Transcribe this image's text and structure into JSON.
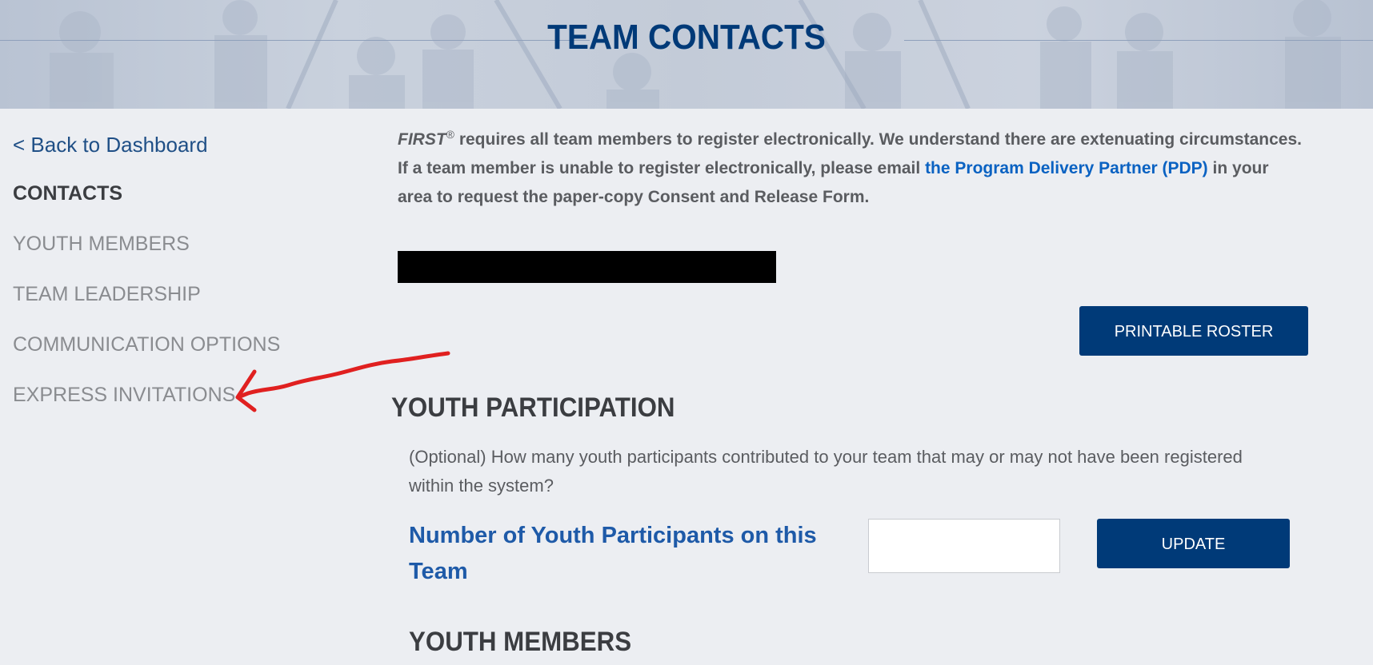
{
  "header": {
    "title": "TEAM CONTACTS"
  },
  "sidebar": {
    "back_link": "< Back to Dashboard",
    "items": [
      {
        "label": "CONTACTS",
        "active": true
      },
      {
        "label": "YOUTH MEMBERS",
        "active": false
      },
      {
        "label": "TEAM LEADERSHIP",
        "active": false
      },
      {
        "label": "COMMUNICATION OPTIONS",
        "active": false
      },
      {
        "label": "EXPRESS INVITATIONS",
        "active": false
      }
    ]
  },
  "main": {
    "intro": {
      "brand": "FIRST",
      "registered_mark": "®",
      "text_before_link": " requires all team members to register electronically. We understand there are extenuating circumstances. If a team member is unable to register electronically, please email ",
      "link_text": "the Program Delivery Partner (PDP)",
      "text_after_link": " in your area to request the paper-copy Consent and Release Form."
    },
    "printable_roster_button": "PRINTABLE ROSTER",
    "youth_participation": {
      "title": "YOUTH PARTICIPATION",
      "optional_text": "(Optional) How many youth participants contributed to your team that may or may not have been registered within the system?",
      "field_label": "Number of Youth Participants on this Team",
      "field_value": "",
      "update_button": "UPDATE"
    },
    "youth_members_title": "YOUTH MEMBERS"
  },
  "colors": {
    "brand_navy": "#003a78",
    "link_blue": "#0a62c2",
    "label_blue": "#1e5aa8",
    "annotation_red": "#e02020",
    "background": "#eceef2"
  }
}
